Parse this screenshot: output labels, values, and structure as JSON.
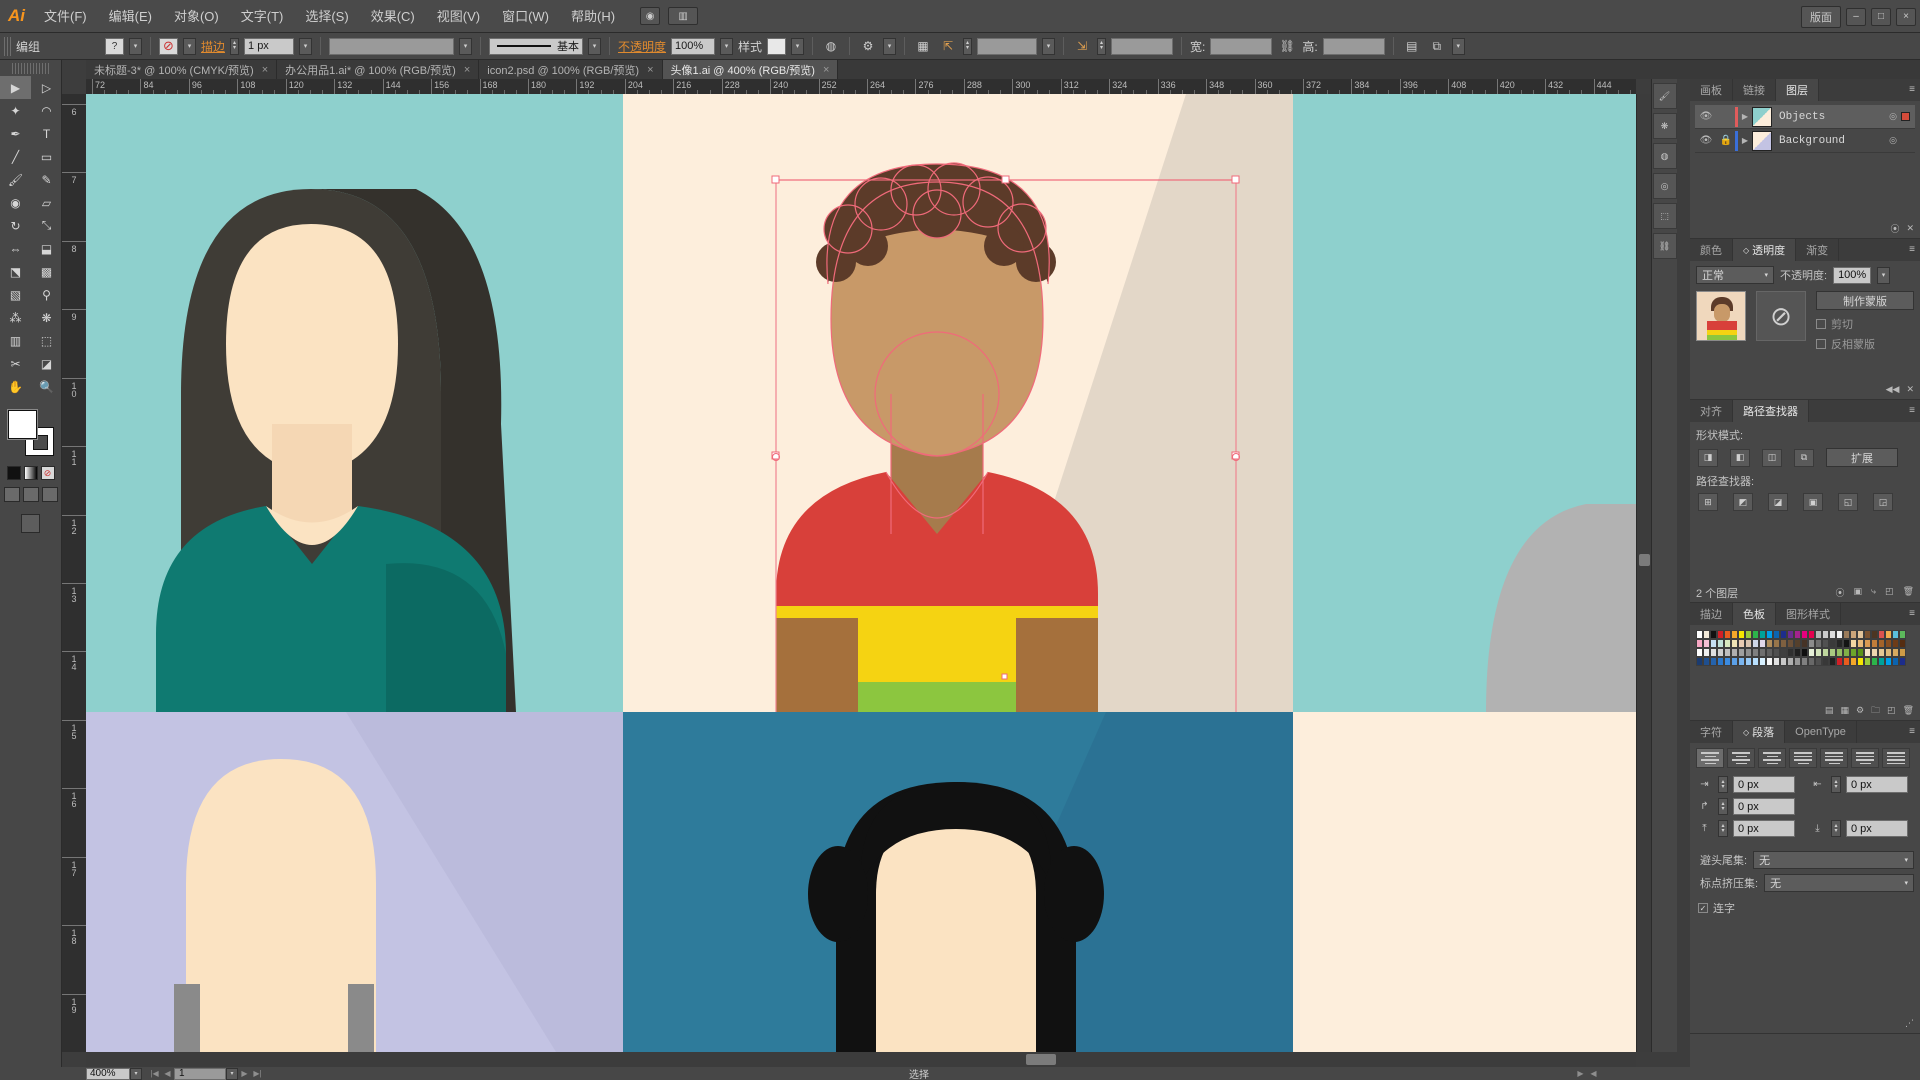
{
  "app": {
    "name": "Ai",
    "workspace_label": "版面"
  },
  "menubar": {
    "items": [
      "文件(F)",
      "编辑(E)",
      "对象(O)",
      "文字(T)",
      "选择(S)",
      "效果(C)",
      "视图(V)",
      "窗口(W)",
      "帮助(H)"
    ]
  },
  "options_bar": {
    "selection_label": "编组",
    "fill_label": "?",
    "stroke_link": "描边",
    "stroke_weight": "1 px",
    "brush_label": "",
    "style_profile": "基本",
    "opacity_link": "不透明度",
    "opacity_value": "100%",
    "style_label": "样式",
    "transform_x": "",
    "transform_y": "",
    "width_label": "宽:",
    "width_value": "",
    "height_label": "高:",
    "height_value": ""
  },
  "document_tabs": [
    {
      "label": "未标题-3* @ 100% (CMYK/预览)",
      "active": false,
      "close": "×"
    },
    {
      "label": "办公用品1.ai* @ 100% (RGB/预览)",
      "active": false,
      "close": "×"
    },
    {
      "label": "icon2.psd @ 100% (RGB/预览)",
      "active": false,
      "close": "×"
    },
    {
      "label": "头像1.ai @ 400% (RGB/预览)",
      "active": true,
      "close": "×"
    }
  ],
  "toolbox": {
    "tools": [
      "selection-tool",
      "direct-selection-tool",
      "magic-wand-tool",
      "lasso-tool",
      "pen-tool",
      "type-tool",
      "line-tool",
      "rectangle-tool",
      "paintbrush-tool",
      "pencil-tool",
      "blob-brush-tool",
      "eraser-tool",
      "rotate-tool",
      "scale-tool",
      "width-tool",
      "shape-builder-tool",
      "perspective-grid-tool",
      "mesh-tool",
      "gradient-tool",
      "eyedropper-tool",
      "blend-tool",
      "symbol-sprayer-tool",
      "artboard-tool",
      "slice-tool",
      "hand-tool",
      "zoom-tool"
    ],
    "fill_color": "#ffffff",
    "stroke_color": "#ffffff"
  },
  "rulers": {
    "unit": "px",
    "h_labels": [
      "72",
      "84",
      "96",
      "108",
      "120",
      "132",
      "144",
      "156",
      "168",
      "180",
      "192",
      "204",
      "216",
      "228",
      "240",
      "252",
      "264",
      "276",
      "288",
      "300",
      "312",
      "324",
      "336",
      "348",
      "360",
      "372",
      "384",
      "396",
      "408",
      "420",
      "432",
      "444"
    ],
    "v_labels": [
      "6",
      "7",
      "8",
      "9",
      "10",
      "11",
      "12",
      "13",
      "14",
      "15",
      "16",
      "17",
      "18",
      "19"
    ]
  },
  "canvas": {
    "zoom": "400%",
    "colors": {
      "teal_bg": "#8ed0cd",
      "dark_hair": "#3f3c36",
      "skin_light": "#fbe3c2",
      "teal_shirt": "#0f7a71",
      "cream_bg": "#fdeedc",
      "beige_shadow": "#ded2c4",
      "brown_hair": "#5c3b29",
      "skin_tan": "#c89968",
      "skin_tan_dark": "#a67b4c",
      "red_shirt": "#d8403a",
      "yellow": "#f5d312",
      "green": "#8cc63f",
      "brown_box": "#a5703c",
      "lavender_bg": "#c3c3e3",
      "blue_bg": "#2e7b9b",
      "black_hair": "#111111",
      "grey_shape": "#b2b2b2",
      "selection_pink": "#f06a7a",
      "guide_pink": "#f08a96"
    }
  },
  "statusbar": {
    "zoom": "400%",
    "page": "1",
    "status_text": "选择"
  },
  "panels": {
    "layers": {
      "tabs": [
        "画板",
        "链接",
        "图层"
      ],
      "active_tab": "图层",
      "rows": [
        {
          "name": "Objects",
          "selected": true,
          "locked": false,
          "color": "#e05c5c",
          "target_dot": "◎",
          "sel_color": "#d44b3a"
        },
        {
          "name": "Background",
          "selected": false,
          "locked": true,
          "color": "#3a6fd8",
          "target_dot": "◎",
          "sel_color": ""
        }
      ],
      "footer_count": ""
    },
    "transparency": {
      "tabs": [
        "颜色",
        "透明度",
        "渐变"
      ],
      "active_tab": "透明度",
      "blend_mode": "正常",
      "opacity_label": "不透明度:",
      "opacity_value": "100%",
      "make_mask_button": "制作蒙版",
      "clip_label": "剪切",
      "invert_label": "反相蒙版"
    },
    "pathfinder": {
      "tabs": [
        "对齐",
        "路径查找器"
      ],
      "active_tab": "路径查找器",
      "shape_modes_label": "形状模式:",
      "expand_button": "扩展",
      "pathfinders_label": "路径查找器:",
      "layer_count_text": "2 个图层"
    },
    "swatches": {
      "tabs": [
        "描边",
        "色板",
        "图形样式"
      ],
      "active_tab": "色板",
      "rows": [
        [
          "#ffffff",
          "#f2e9d8",
          "#111111",
          "#d21f26",
          "#e85c1e",
          "#f3a72a",
          "#f6e500",
          "#9acb3b",
          "#2db34a",
          "#00a29a",
          "#00a0e9",
          "#0b64b0",
          "#1d2d8b",
          "#6b2c91",
          "#a3238f",
          "#e4007f",
          "#e5004f",
          "#b5b5b5",
          "#c9c9c9",
          "#dcdcdc",
          "#f0f0f0",
          "#9a7b5a",
          "#c9a47a",
          "#e0c39a",
          "#7a5230",
          "#4c3522",
          "#d9534f",
          "#f0ad4e",
          "#5bc0de",
          "#5cb85c"
        ],
        [
          "#f7a8c4",
          "#f4bfd4",
          "#c6dff2",
          "#bfe0d8",
          "#d7e8bf",
          "#efe3b5",
          "#e8cbb2",
          "#d9c3ae",
          "#cfd8e8",
          "#e2d8ea",
          "#b08d5b",
          "#97754a",
          "#7e6040",
          "#6b5038",
          "#55402c",
          "#463326",
          "#8c8c8c",
          "#6e6e6e",
          "#515151",
          "#3a3a3a",
          "#262626",
          "#141414",
          "#f2d6a3",
          "#e8b97a",
          "#d99a52",
          "#c07d3a",
          "#a5642a",
          "#8a4f20",
          "#6e3c18",
          "#552d11"
        ],
        [
          "#ffffff",
          "#efefef",
          "#dfdfdf",
          "#cfcfcf",
          "#bfbfbf",
          "#afafaf",
          "#9f9f9f",
          "#8f8f8f",
          "#7f7f7f",
          "#6f6f6f",
          "#5f5f5f",
          "#4f4f4f",
          "#3f3f3f",
          "#2f2f2f",
          "#1f1f1f",
          "#0f0f0f",
          "#e6f0d8",
          "#d3e4bb",
          "#bfd79e",
          "#aaca81",
          "#96be64",
          "#81b147",
          "#6da52a",
          "#5a9418",
          "#f6e6c8",
          "#eed7ae",
          "#e6c894",
          "#deb97a",
          "#d6aa60",
          "#ce9b46"
        ],
        [
          "#1b3b6f",
          "#1f4f8f",
          "#2563ad",
          "#2b77cb",
          "#3b8be0",
          "#5ba0e8",
          "#7ab5ef",
          "#99caf6",
          "#b8dffd",
          "#d7f0ff",
          "#f7f7f7",
          "#e0e0e0",
          "#c8c8c8",
          "#b0b0b0",
          "#989898",
          "#808080",
          "#686868",
          "#505050",
          "#383838",
          "#202020",
          "#d21f26",
          "#e85c1e",
          "#f3a72a",
          "#f6e500",
          "#9acb3b",
          "#2db34a",
          "#00a29a",
          "#00a0e9",
          "#0b64b0",
          "#1d2d8b"
        ]
      ]
    },
    "paragraph": {
      "tabs": [
        "字符",
        "段落",
        "OpenType"
      ],
      "active_tab": "段落",
      "indent_left": "0 px",
      "indent_right": "0 px",
      "indent_first": "0 px",
      "space_before": "0 px",
      "space_after": "0 px",
      "kinsoku_label": "避头尾集:",
      "kinsoku_value": "无",
      "mojikumi_label": "标点挤压集:",
      "mojikumi_value": "无",
      "hyphenate_label": "连字",
      "hyphenate_checked": true
    }
  },
  "dock_icons": [
    "brush-panel-icon",
    "symbols-panel-icon",
    "graphic-styles-panel-icon",
    "appearance-panel-icon",
    "transform-panel-icon",
    "links-panel-icon"
  ]
}
